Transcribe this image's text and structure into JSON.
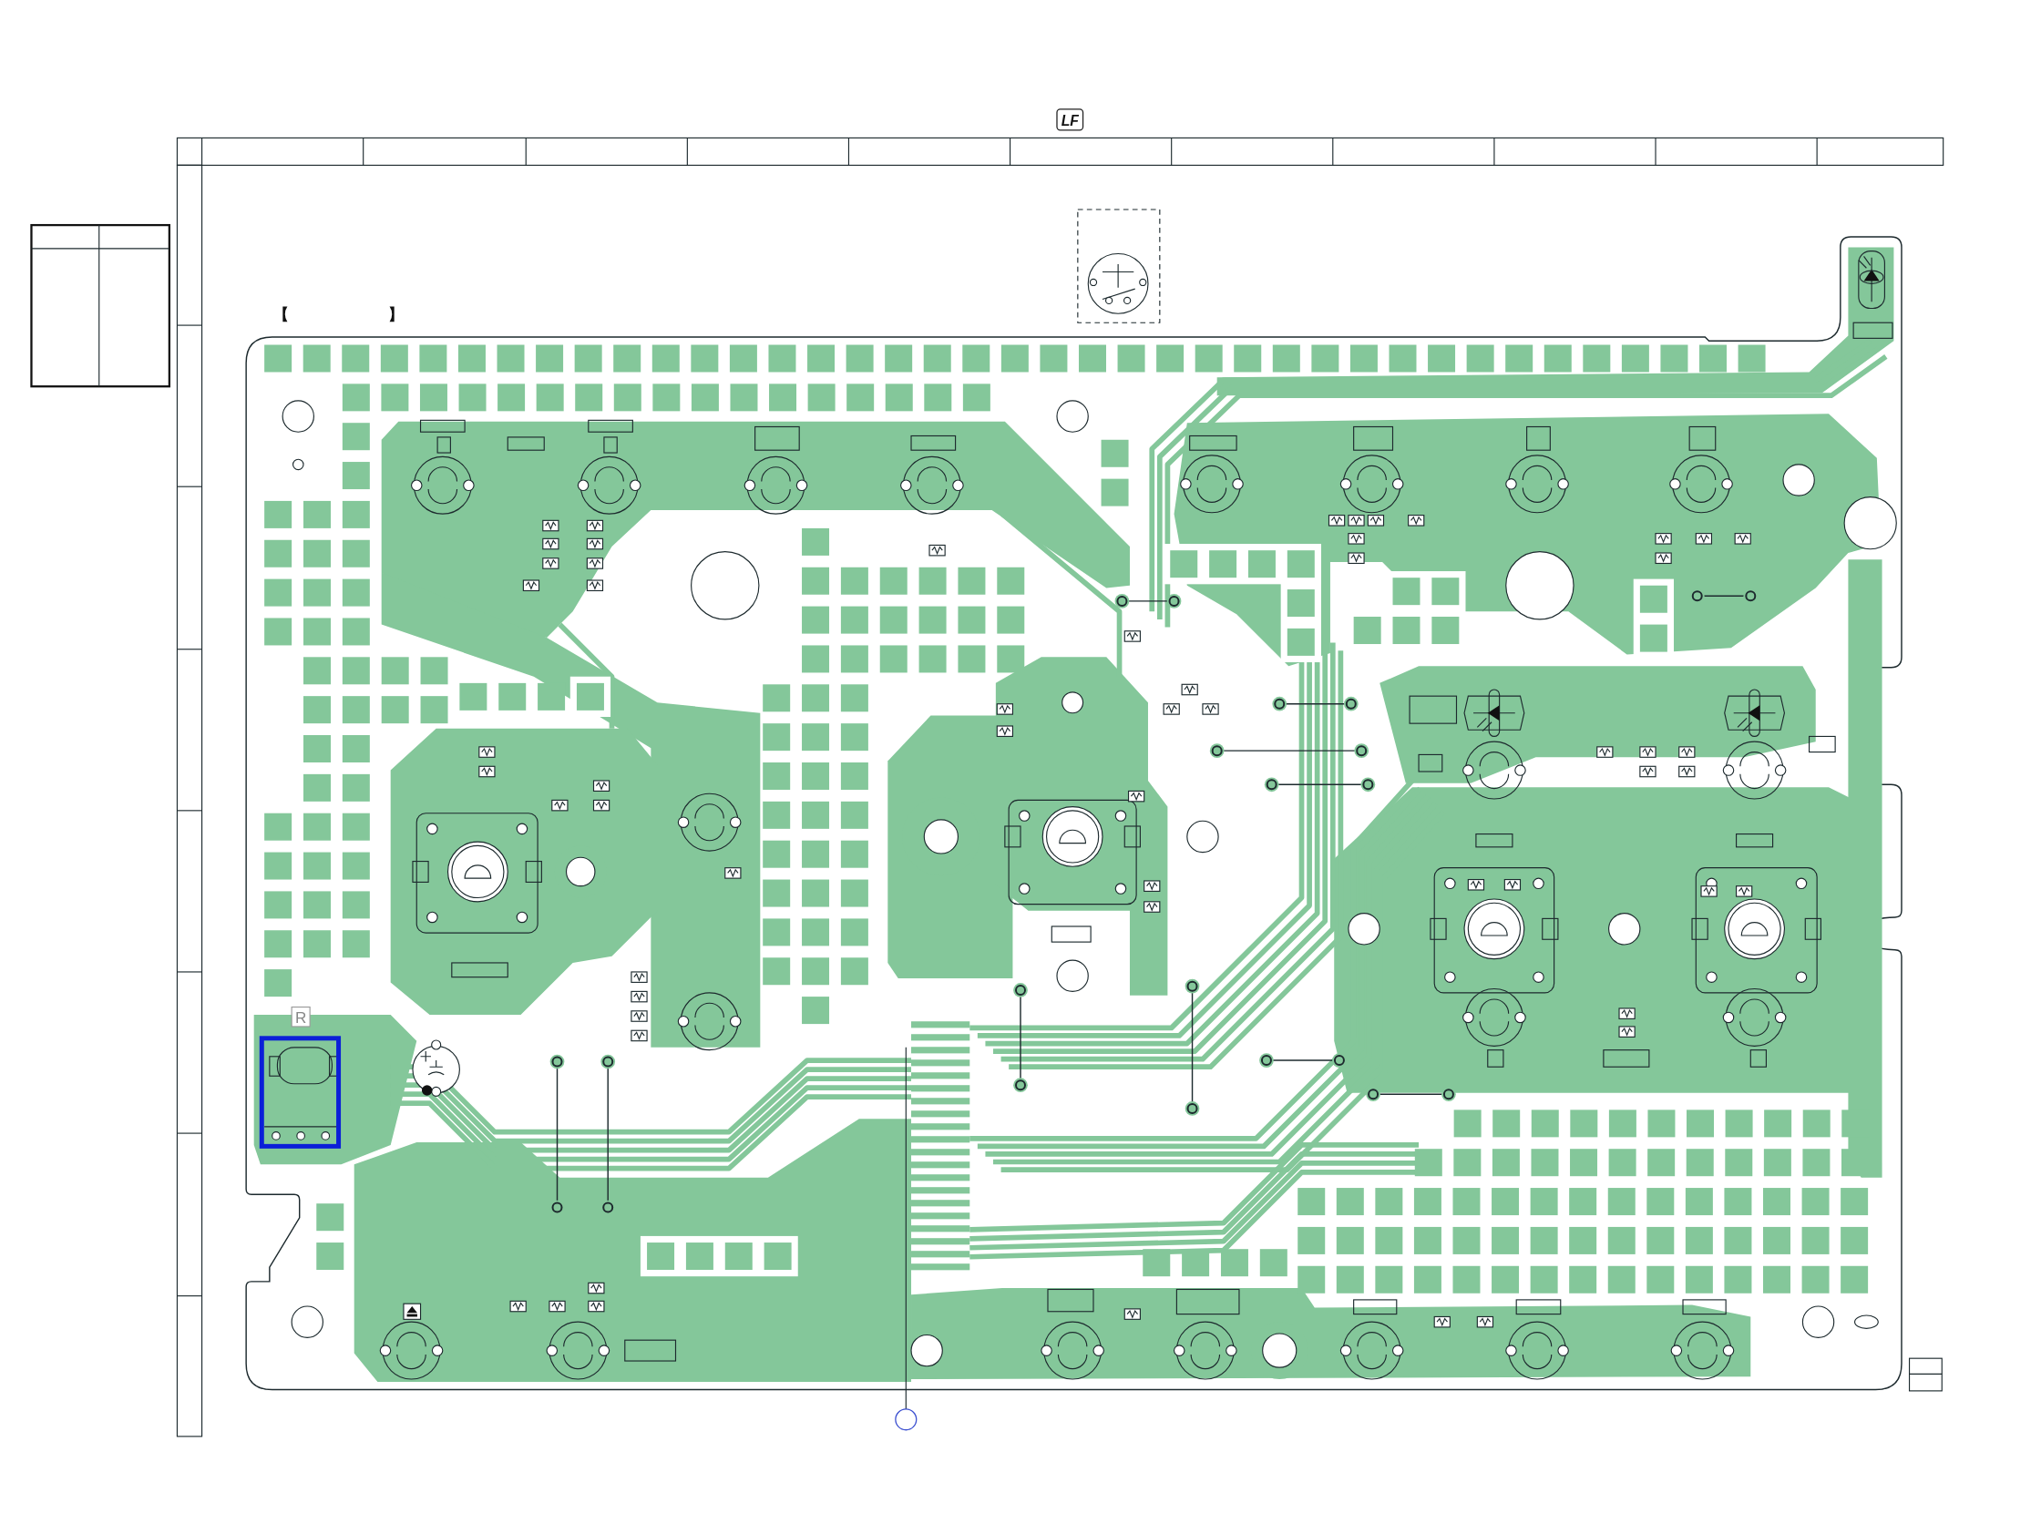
{
  "sheet": {
    "brackets": [
      "【",
      "】"
    ],
    "lead_free_mark": "LF"
  },
  "marked_part": {
    "mark": "R",
    "highlighted": true
  }
}
